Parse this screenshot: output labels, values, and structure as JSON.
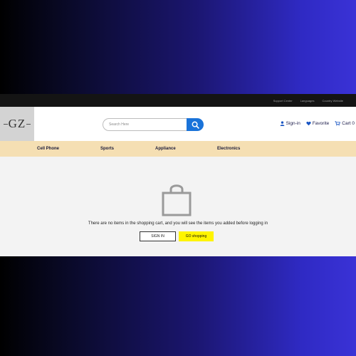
{
  "topbar": {
    "links": [
      "Support Center",
      "Languages",
      "Country Website"
    ]
  },
  "logo": {
    "text": "GZ"
  },
  "search": {
    "placeholder": "Search Here",
    "icon": "search-icon"
  },
  "header": {
    "signin_label": "Sign-in",
    "favorite_label": "Favorite",
    "cart_label": "Cart 0"
  },
  "nav": {
    "items": [
      "Cell Phone",
      "Sports",
      "Appliance",
      "Electronics"
    ]
  },
  "empty_cart": {
    "icon": "shopping-bag-icon",
    "message": "There are no items in the shopping cart, and you will see the items you added before logging in",
    "signin_button": "SIGN IN",
    "go_button": "GO shopping"
  },
  "colors": {
    "accent_blue": "#1a73d9",
    "nav_bg": "#f5dfb3",
    "go_button_bg": "#fff400",
    "topbar_bg": "#141414"
  }
}
